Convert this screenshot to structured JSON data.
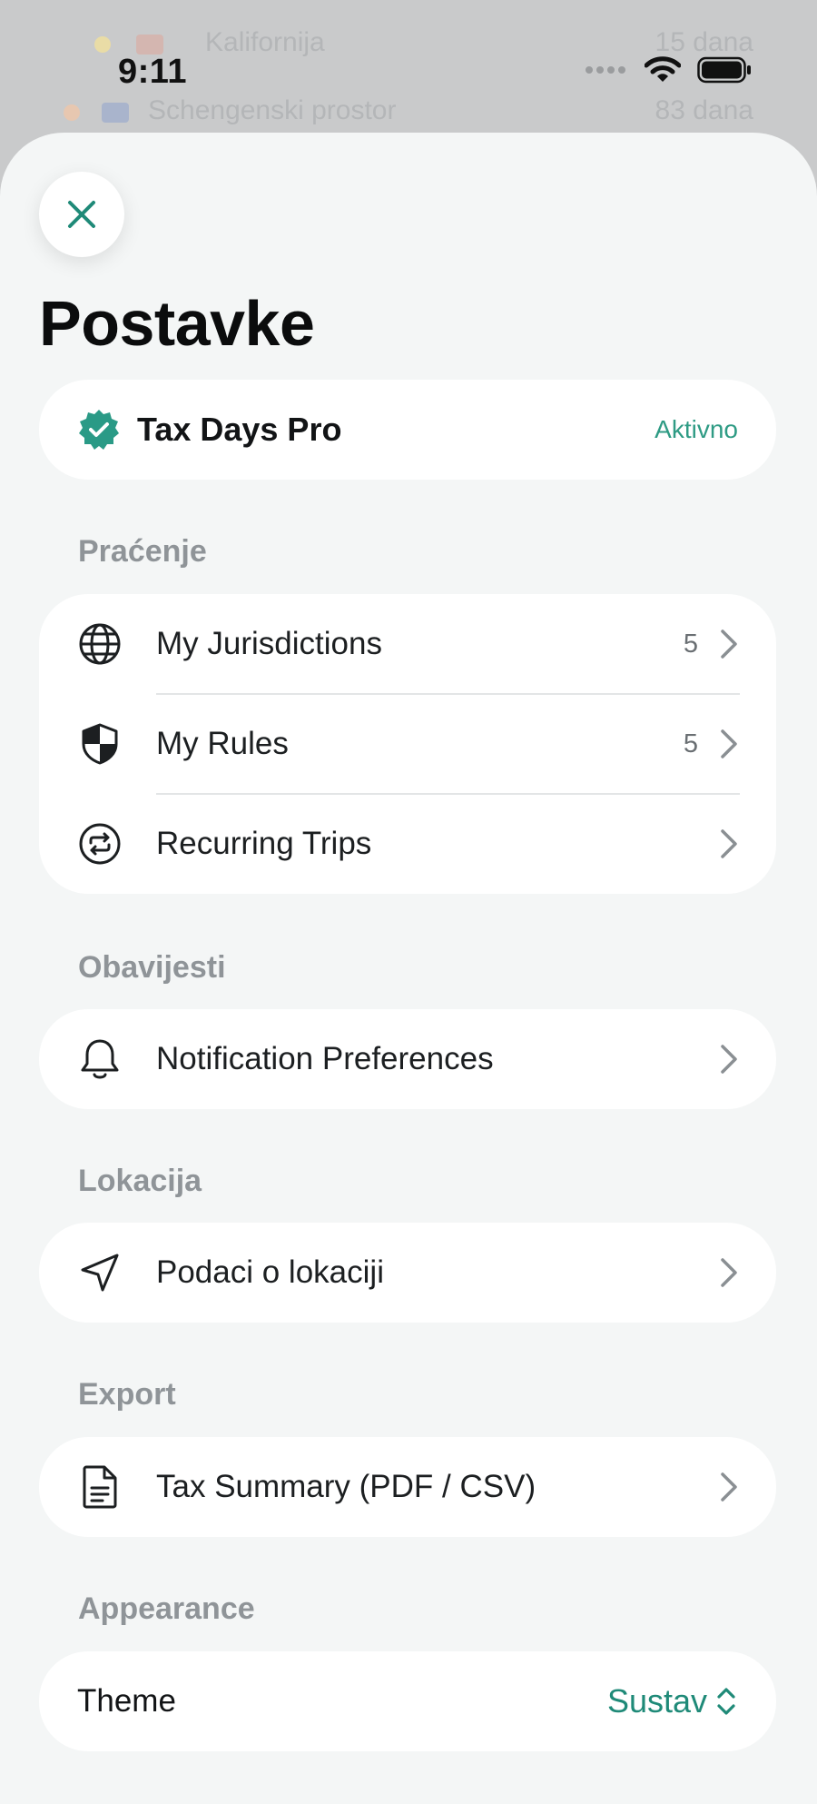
{
  "background": {
    "rows": [
      {
        "label": "Kalifornija",
        "right": "15 dana"
      },
      {
        "label": "Schengenski prostor",
        "right": "83 dana"
      }
    ]
  },
  "status_bar": {
    "time": "9:11"
  },
  "header": {
    "title": "Postavke"
  },
  "pro": {
    "name": "Tax Days Pro",
    "status": "Aktivno"
  },
  "sections": {
    "tracking": {
      "label": "Praćenje",
      "items": [
        {
          "label": "My Jurisdictions",
          "count": "5",
          "icon": "globe-icon"
        },
        {
          "label": "My Rules",
          "count": "5",
          "icon": "shield-icon"
        },
        {
          "label": "Recurring Trips",
          "count": "",
          "icon": "repeat-icon"
        }
      ]
    },
    "notifications": {
      "label": "Obavijesti",
      "items": [
        {
          "label": "Notification Preferences",
          "icon": "bell-icon"
        }
      ]
    },
    "location": {
      "label": "Lokacija",
      "items": [
        {
          "label": "Podaci o lokaciji",
          "icon": "location-arrow-icon"
        }
      ]
    },
    "export": {
      "label": "Export",
      "items": [
        {
          "label": "Tax Summary (PDF / CSV)",
          "icon": "document-icon"
        }
      ]
    },
    "appearance": {
      "label": "Appearance",
      "theme_label": "Theme",
      "theme_value": "Sustav"
    }
  },
  "colors": {
    "accent": "#1f8a78",
    "badge": "#2a9a86",
    "sheet": "#f4f6f6"
  }
}
